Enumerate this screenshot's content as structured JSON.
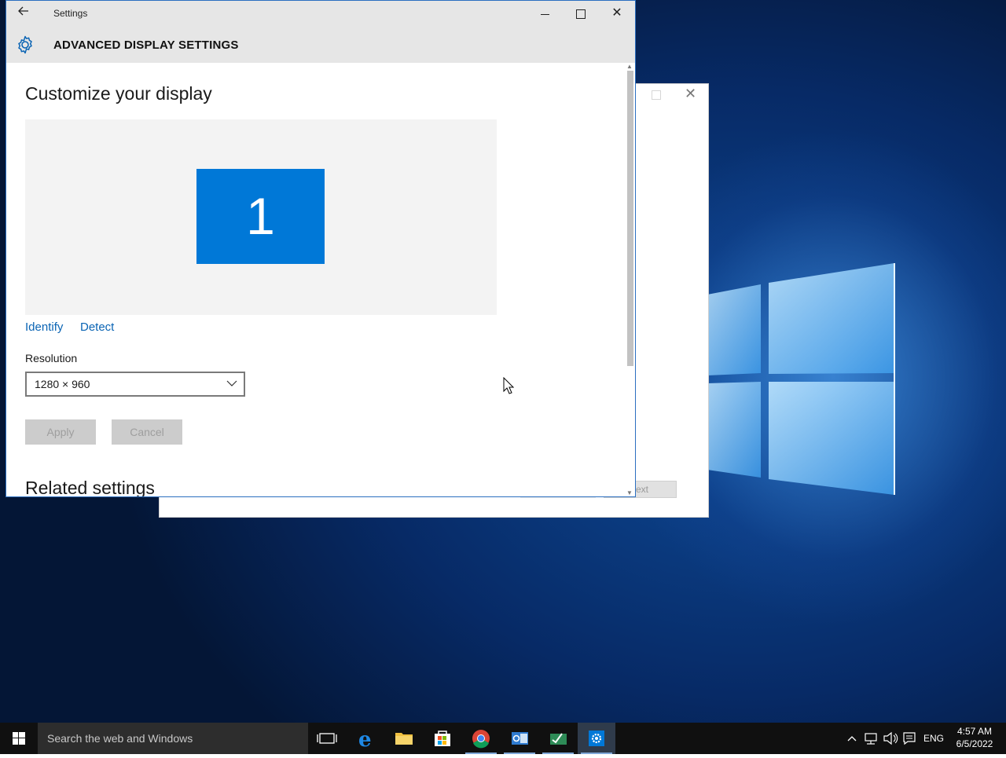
{
  "settings_window": {
    "title": "Settings",
    "header_title": "ADVANCED DISPLAY SETTINGS",
    "page_heading": "Customize your display",
    "monitor_number": "1",
    "identify_link": "Identify",
    "detect_link": "Detect",
    "resolution_label": "Resolution",
    "resolution_value": "1280 × 960",
    "apply_label": "Apply",
    "cancel_label": "Cancel",
    "related_heading": "Related settings"
  },
  "background_dialog": {
    "next_button_partial": "ext"
  },
  "taskbar": {
    "search_placeholder": "Search the web and Windows",
    "language": "ENG",
    "time": "4:57 AM",
    "date": "6/5/2022",
    "apps": [
      "task-view",
      "edge",
      "file-explorer",
      "store",
      "chrome",
      "outlook",
      "project",
      "settings"
    ]
  },
  "colors": {
    "accent": "#0078d7",
    "link": "#0a64b4",
    "titlebar": "#e6e6e6",
    "taskbar": "#101010"
  }
}
